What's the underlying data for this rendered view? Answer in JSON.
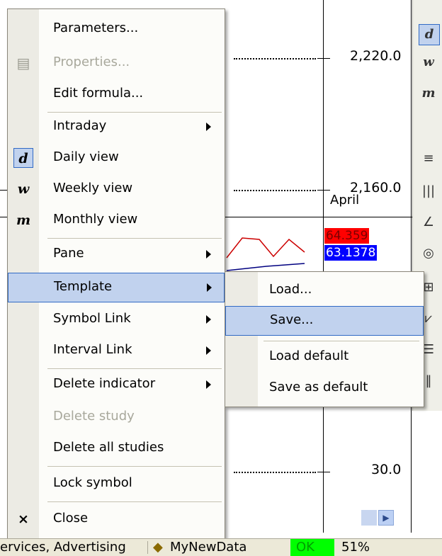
{
  "chart": {
    "price_labels": [
      "2,220.0",
      "2,160.0",
      "30.0"
    ],
    "month_label": "April",
    "value_red": "64.359",
    "value_blue": "63.1378",
    "colors": {
      "red_box": "#ff0000",
      "blue_box": "#0000ff",
      "line_red": "#cc0000",
      "line_blue": "#000080"
    }
  },
  "toolbar": {
    "items": [
      {
        "icon": "d-daily-icon",
        "glyph": "d",
        "selected": true
      },
      {
        "icon": "w-weekly-icon",
        "glyph": "w"
      },
      {
        "icon": "m-monthly-icon",
        "glyph": "m"
      },
      {
        "icon": "horizontal-lines-icon",
        "glyph": "≡"
      },
      {
        "icon": "vertical-lines-icon",
        "glyph": "|||"
      },
      {
        "icon": "trendline-icon",
        "glyph": "∠"
      },
      {
        "icon": "arcs-icon",
        "glyph": "◎"
      },
      {
        "icon": "grid-icon",
        "glyph": "⊞"
      },
      {
        "icon": "fan-icon",
        "glyph": "⩗"
      },
      {
        "icon": "text-lines-icon",
        "glyph": "☰"
      },
      {
        "icon": "cycle-lines-icon",
        "glyph": "‖"
      }
    ]
  },
  "menu": {
    "items": [
      {
        "label": "Parameters...",
        "icon": ""
      },
      {
        "label": "Properties...",
        "icon": "properties-icon",
        "disabled": true
      },
      {
        "label": "Edit formula...",
        "icon": ""
      },
      {
        "label": "Intraday",
        "submenu": true
      },
      {
        "label": "Daily view",
        "icon": "d",
        "checked": true
      },
      {
        "label": "Weekly view",
        "icon": "w"
      },
      {
        "label": "Monthly view",
        "icon": "m"
      },
      {
        "label": "Pane",
        "submenu": true
      },
      {
        "label": "Template",
        "submenu": true,
        "highlighted": true
      },
      {
        "label": "Symbol Link",
        "submenu": true
      },
      {
        "label": "Interval Link",
        "submenu": true
      },
      {
        "label": "Delete indicator",
        "submenu": true
      },
      {
        "label": "Delete study",
        "disabled": true
      },
      {
        "label": "Delete all studies"
      },
      {
        "label": "Lock symbol"
      },
      {
        "label": "Close",
        "icon": "×"
      }
    ]
  },
  "submenu": {
    "items": [
      {
        "label": "Load..."
      },
      {
        "label": "Save...",
        "highlighted": true
      },
      {
        "label": "Load default"
      },
      {
        "label": "Save as default"
      }
    ]
  },
  "status": {
    "sector": "ervices, Advertising",
    "data_source": "MyNewData",
    "state": "OK",
    "percent": "51%",
    "state_color": "#00ff00"
  }
}
